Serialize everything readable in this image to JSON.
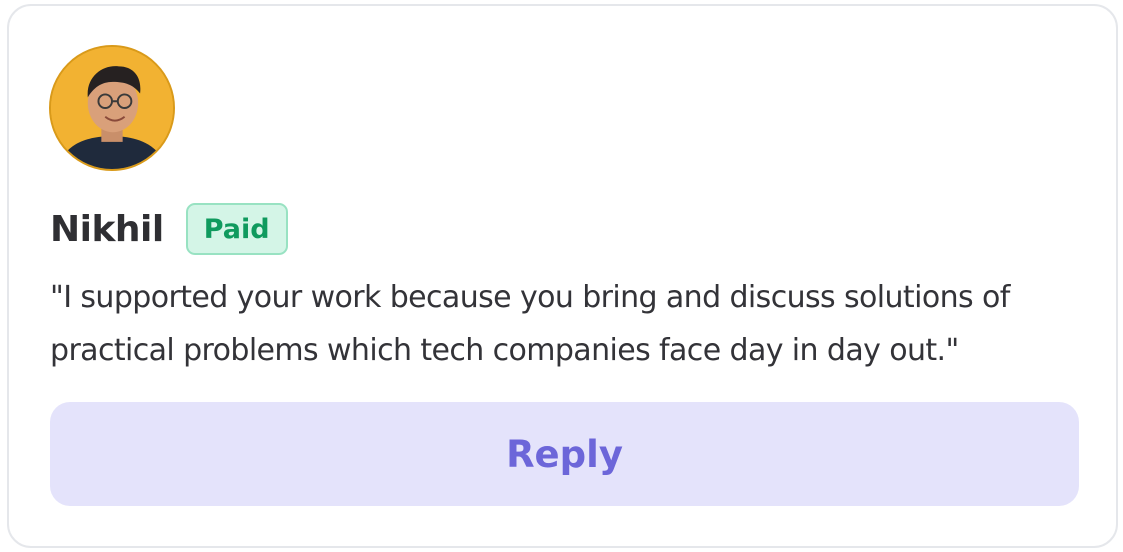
{
  "card": {
    "avatar_icon": "user-photo-avatar",
    "name": "Nikhil",
    "badge": "Paid",
    "message": "\"I supported your work because you bring and discuss solutions of practical problems which tech companies face day in day out.\"",
    "reply_label": "Reply"
  },
  "colors": {
    "badge_bg": "#d4f5e7",
    "badge_text": "#0f9a5e",
    "reply_bg": "#e4e3fb",
    "reply_text": "#6c66d9",
    "avatar_bg": "#f2b232"
  }
}
